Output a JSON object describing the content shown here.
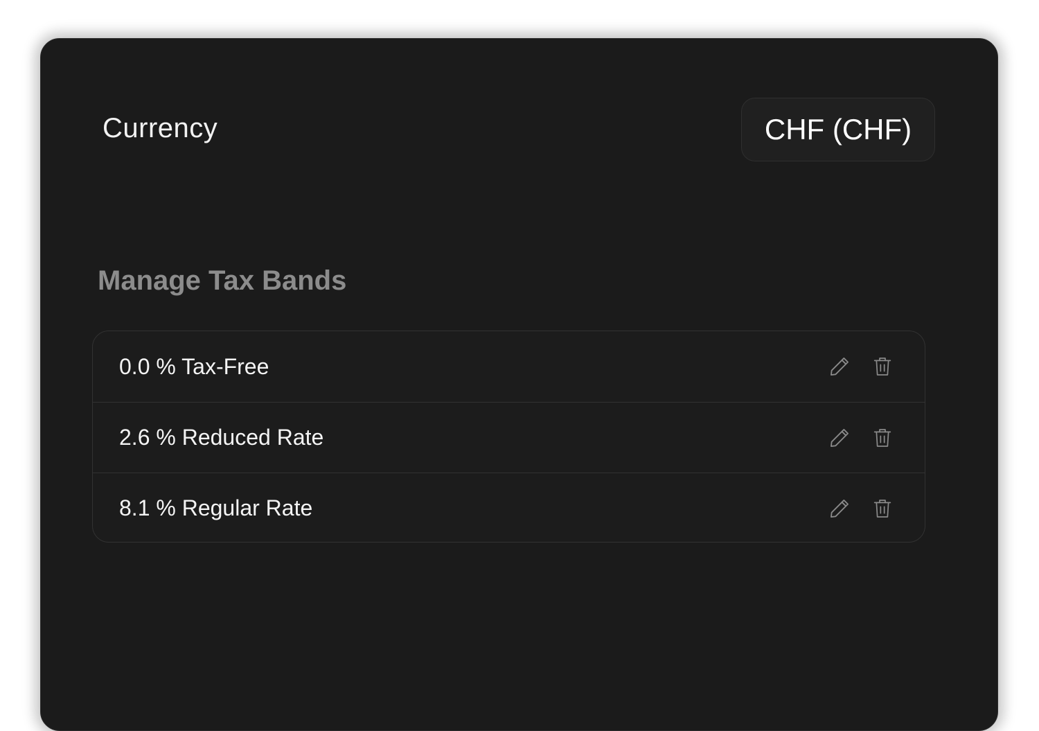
{
  "currency": {
    "label": "Currency",
    "selected": "CHF (CHF)"
  },
  "tax_bands": {
    "title": "Manage Tax Bands",
    "items": [
      {
        "label": "0.0 % Tax-Free"
      },
      {
        "label": "2.6 % Reduced Rate"
      },
      {
        "label": "8.1 % Regular Rate"
      }
    ],
    "edit_icon": "pencil-icon",
    "delete_icon": "trash-icon"
  },
  "colors": {
    "panel_bg": "#1b1b1b",
    "text_primary": "#f4f4f4",
    "text_muted": "#8c8c8c",
    "icon": "#8a8a8a",
    "border": "#323232"
  }
}
